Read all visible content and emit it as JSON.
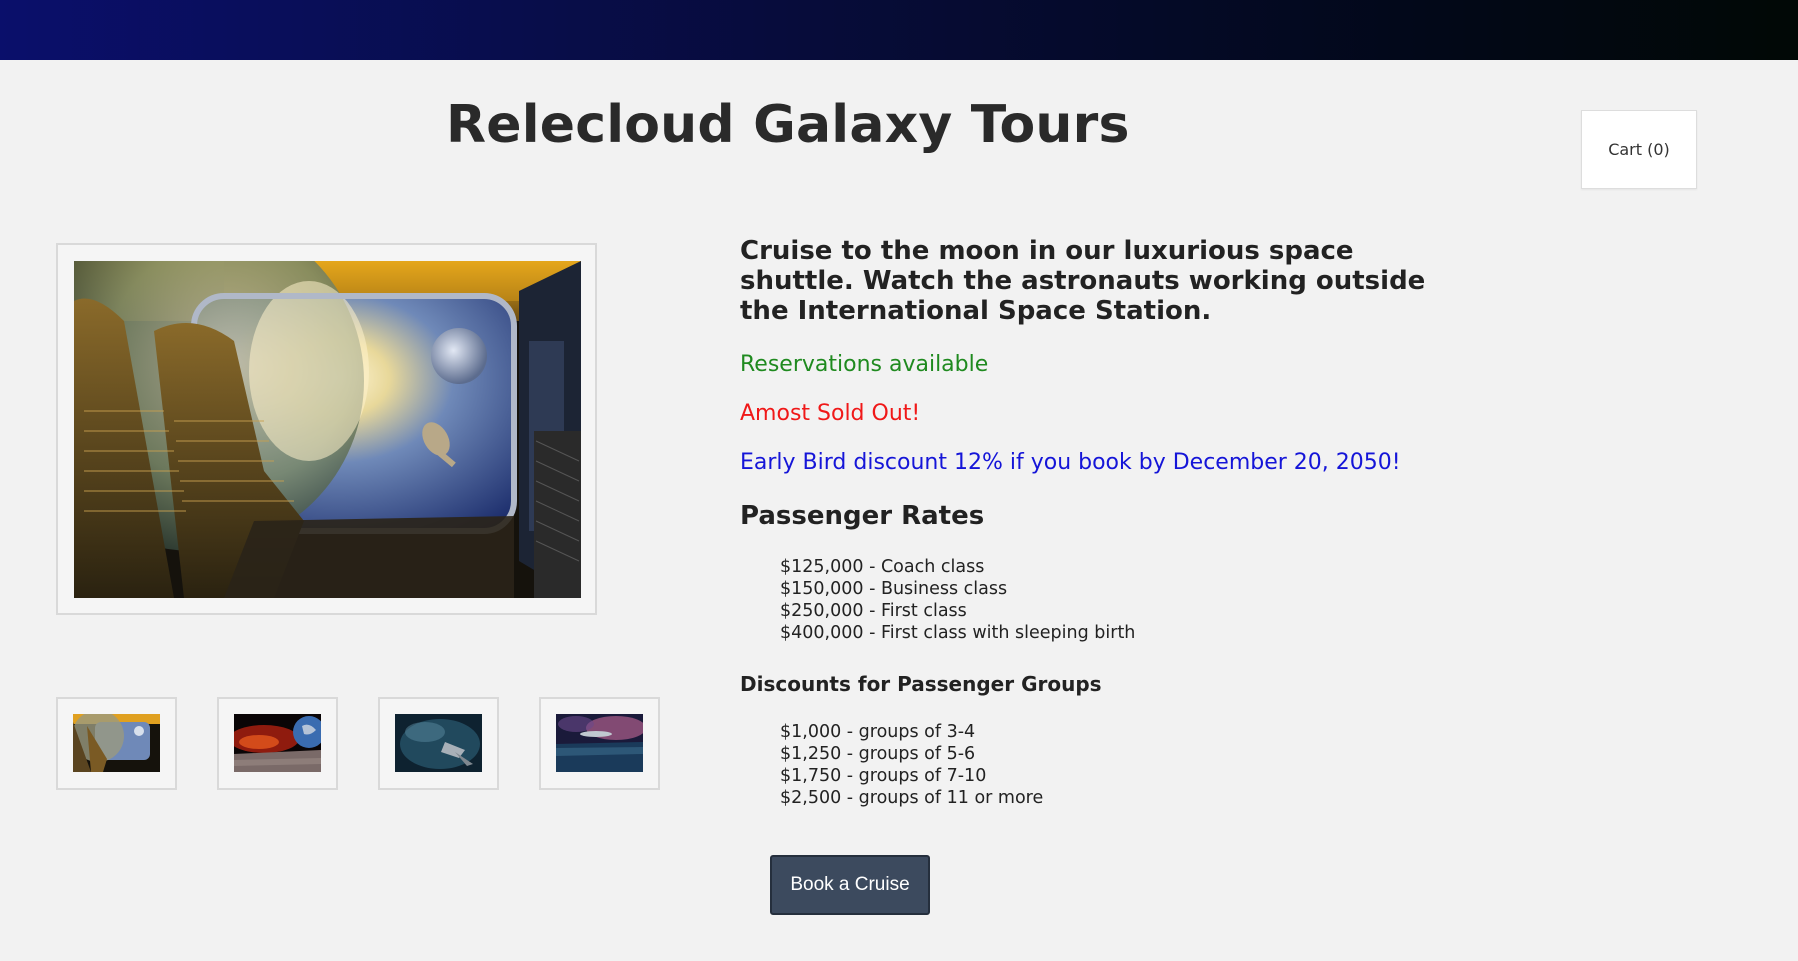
{
  "site": {
    "title": "Relecloud Galaxy Tours"
  },
  "cart": {
    "label": "Cart (0)"
  },
  "tour": {
    "description": "Cruise to the moon in our luxurious space shuttle. Watch the astronauts working outside the International Space Station.",
    "status": {
      "availability": "Reservations available",
      "urgency": "Amost Sold Out!",
      "promo": "Early Bird discount 12% if you book by December 20, 2050!"
    },
    "rates": {
      "heading": "Passenger Rates",
      "items": [
        "$125,000 - Coach class",
        "$150,000 - Business class",
        "$250,000 - First class",
        "$400,000 - First class with sleeping birth"
      ]
    },
    "group_discounts": {
      "heading": "Discounts for Passenger Groups",
      "items": [
        "$1,000 - groups of 3-4",
        "$1,250 - groups of 5-6",
        "$1,750 - groups of 7-10",
        "$2,500 - groups of 11 or more"
      ]
    },
    "book_label": "Book a Cruise"
  },
  "colors": {
    "status_green": "#1f8a1f",
    "status_red": "#f01818",
    "status_blue": "#1515d8",
    "button": "#3c4a5e",
    "header_gradient_start": "#0a0f6b",
    "header_gradient_end": "#010805"
  },
  "gallery": {
    "main_image": "shuttle-cabin-window-image",
    "thumbnails": [
      "shuttle-cabin-thumbnail",
      "planet-surface-thumbnail",
      "nebula-ship-thumbnail",
      "alien-landscape-thumbnail"
    ]
  }
}
